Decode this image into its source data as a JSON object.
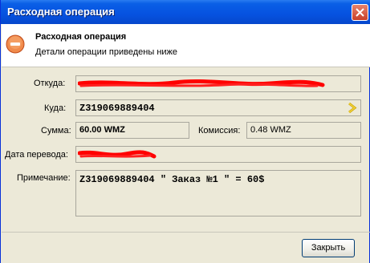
{
  "window": {
    "title": "Расходная операция"
  },
  "header": {
    "title": "Расходная операция",
    "subtitle": "Детали операции приведены ниже"
  },
  "form": {
    "from_label": "Откуда:",
    "to_label": "Куда:",
    "to_value": "Z319069889404",
    "amount_label": "Сумма:",
    "amount_value": "60.00 WMZ",
    "commission_label": "Комиссия:",
    "commission_value": "0.48 WMZ",
    "date_label": "Дата перевода:",
    "note_label": "Примечание:",
    "note_value": "Z319069889404 \" Заказ №1 \" = 60$"
  },
  "buttons": {
    "close_label": "Закрыть"
  },
  "colors": {
    "title_bar": "#0652e0",
    "dialog_bg": "#ece9d8",
    "redaction": "#ff0000",
    "icon_orange": "#e8622a"
  },
  "icons": {
    "header_icon": "minus-circle-icon",
    "to_action_icon": "chevron-right-icon",
    "close_icon": "close-icon"
  }
}
